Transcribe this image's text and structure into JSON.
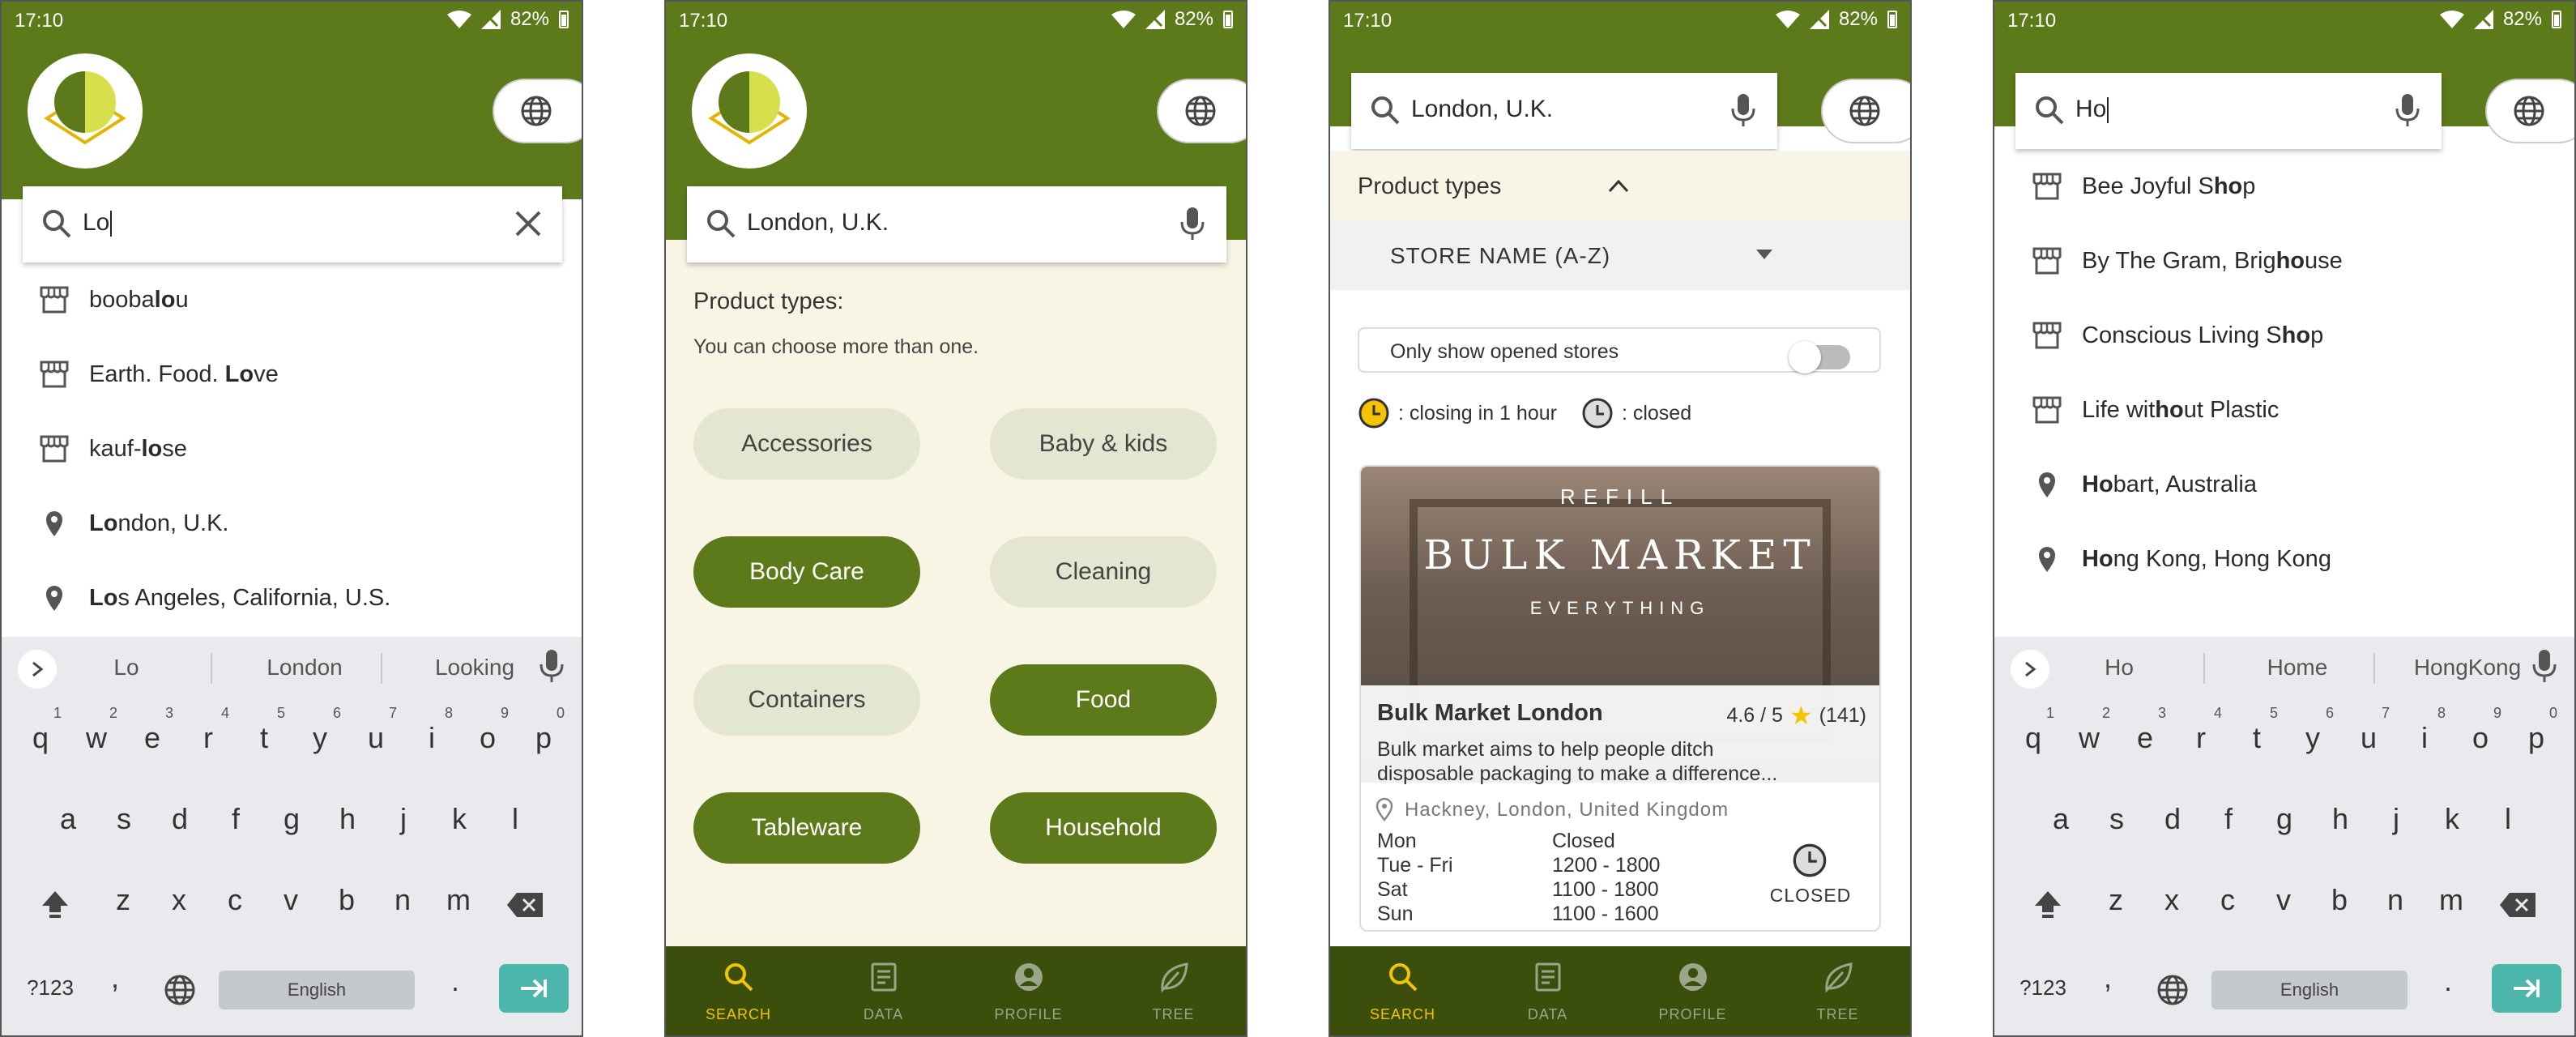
{
  "status_bar": {
    "time": "17:10",
    "battery": "82%"
  },
  "colors": {
    "brand_green": "#5d7a1b",
    "nav_dark": "#3b4e0b",
    "cream": "#f8f5e4",
    "active_nav": "#f5c400",
    "chip_off": "#e3e6d1",
    "enter_key": "#4db6ac"
  },
  "screen1": {
    "search_value": "Lo",
    "suggestions": [
      {
        "icon": "store-icon",
        "pre": "booba",
        "bold": "lo",
        "post": "u"
      },
      {
        "icon": "store-icon",
        "pre": "Earth. Food. ",
        "bold": "Lo",
        "post": "ve"
      },
      {
        "icon": "store-icon",
        "pre": "kauf-",
        "bold": "lo",
        "post": "se"
      },
      {
        "icon": "location-pin-icon",
        "pre": "",
        "bold": "Lo",
        "post": "ndon, U.K."
      },
      {
        "icon": "location-pin-icon",
        "pre": "",
        "bold": "Lo",
        "post": "s Angeles, California, U.S."
      }
    ],
    "keyboard_suggestions": [
      "Lo",
      "London",
      "Looking"
    ]
  },
  "screen2": {
    "search_value": "London, U.K.",
    "product_types_title": "Product types:",
    "product_types_hint": "You can choose more than one.",
    "chips": [
      {
        "label": "Accessories",
        "selected": false
      },
      {
        "label": "Baby & kids",
        "selected": false
      },
      {
        "label": "Body Care",
        "selected": true
      },
      {
        "label": "Cleaning",
        "selected": false
      },
      {
        "label": "Containers",
        "selected": false
      },
      {
        "label": "Food",
        "selected": true
      },
      {
        "label": "Tableware",
        "selected": true
      },
      {
        "label": "Household",
        "selected": true
      }
    ]
  },
  "screen3": {
    "search_value": "London, U.K.",
    "product_types_label": "Product types",
    "sort_label": "STORE NAME (A-Z)",
    "toggle_label": "Only show opened stores",
    "toggle_on": false,
    "legend_closing": ": closing in 1 hour",
    "legend_closed": ": closed",
    "store": {
      "photo_text_top": "REFILL",
      "photo_text_main": "BULK MARKET",
      "photo_text_bottom": "EVERYTHING",
      "name": "Bulk Market London",
      "rating": "4.6 / 5",
      "reviews": "(141)",
      "description_line1": "Bulk market aims to help people ditch",
      "description_line2": "disposable packaging to make a difference...",
      "address": "Hackney, London, United Kingdom",
      "hours": [
        {
          "day": "Mon",
          "time": "Closed"
        },
        {
          "day": "Tue - Fri",
          "time": "1200 - 1800"
        },
        {
          "day": "Sat",
          "time": "1100 - 1800"
        },
        {
          "day": "Sun",
          "time": "1100 - 1600"
        }
      ],
      "status": "CLOSED"
    }
  },
  "screen4": {
    "search_value": "Ho",
    "suggestions": [
      {
        "icon": "store-icon",
        "pre": "Bee Joyful S",
        "bold": "ho",
        "post": "p"
      },
      {
        "icon": "store-icon",
        "pre": "By The Gram, Brig",
        "bold": "ho",
        "post": "use"
      },
      {
        "icon": "store-icon",
        "pre": "Conscious Living S",
        "bold": "ho",
        "post": "p"
      },
      {
        "icon": "store-icon",
        "pre": "Life wit",
        "bold": "ho",
        "post": "ut Plastic"
      },
      {
        "icon": "location-pin-icon",
        "pre": "",
        "bold": "Ho",
        "post": "bart, Australia"
      },
      {
        "icon": "location-pin-icon",
        "pre": "",
        "bold": "Ho",
        "post": "ng Kong, Hong Kong"
      }
    ],
    "keyboard_suggestions": [
      "Ho",
      "Home",
      "HongKong"
    ]
  },
  "keyboard": {
    "row1": [
      "q",
      "w",
      "e",
      "r",
      "t",
      "y",
      "u",
      "i",
      "o",
      "p"
    ],
    "row1_digits": [
      "1",
      "2",
      "3",
      "4",
      "5",
      "6",
      "7",
      "8",
      "9",
      "0"
    ],
    "row2": [
      "a",
      "s",
      "d",
      "f",
      "g",
      "h",
      "j",
      "k",
      "l"
    ],
    "row3": [
      "z",
      "x",
      "c",
      "v",
      "b",
      "n",
      "m"
    ],
    "symbols_key": "?123",
    "comma_key": ",",
    "period_key": ".",
    "space_label": "English"
  },
  "nav": [
    {
      "label": "SEARCH",
      "icon": "search-icon"
    },
    {
      "label": "DATA",
      "icon": "document-icon"
    },
    {
      "label": "PROFILE",
      "icon": "profile-icon"
    },
    {
      "label": "TREE",
      "icon": "leaf-icon"
    }
  ]
}
